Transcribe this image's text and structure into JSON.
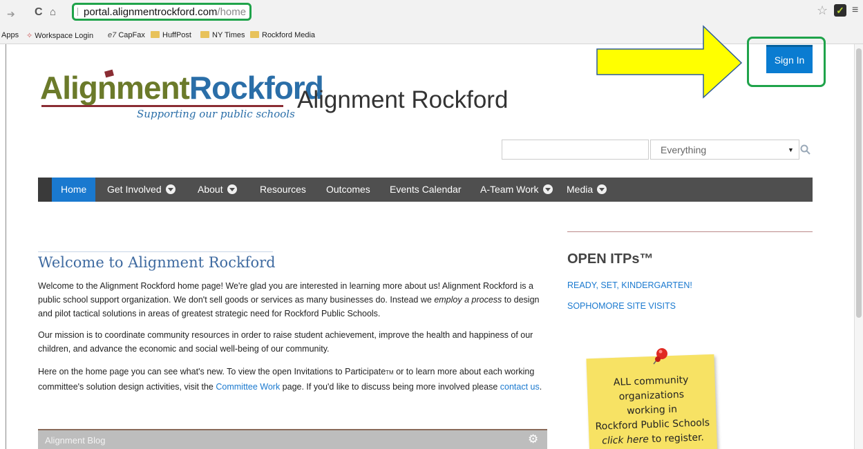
{
  "browser": {
    "url_host": "portal.alignmentrockford.com",
    "url_path": "/home",
    "bookmarks": [
      "Apps",
      "Workspace Login",
      "CapFax",
      "HuffPost",
      "NY Times",
      "Rockford Media"
    ]
  },
  "header": {
    "logo_word1": "Alignment",
    "logo_word2": "Rockford",
    "logo_tagline": "Supporting our public schools",
    "site_title": "Alignment Rockford",
    "signin_label": "Sign In"
  },
  "search": {
    "value": "",
    "scope": "Everything"
  },
  "nav": {
    "items": [
      {
        "label": "Home"
      },
      {
        "label": "Get Involved"
      },
      {
        "label": "About"
      },
      {
        "label": "Resources"
      },
      {
        "label": "Outcomes"
      },
      {
        "label": "Events Calendar"
      },
      {
        "label": "A-Team Work"
      },
      {
        "label": "Media"
      }
    ]
  },
  "main": {
    "heading": "Welcome to Alignment Rockford",
    "p1_a": "Welcome to the Alignment Rockford home page!  We're glad you are interested in learning more about us!  Alignment Rockford is a public school support organization.  We don't sell goods or services as many businesses do.  Instead we ",
    "p1_em": "employ a process",
    "p1_b": " to design and pilot tactical solutions in areas of greatest strategic need for Rockford Public Schools.",
    "p2": "Our mission is to coordinate community resources in order to raise student achievement, improve the health and happiness of our children, and advance the economic and social well-being of our community.",
    "p3_a": "Here on the home page you can see what's new. To view the open Invitations to Participate",
    "p3_tm": "TM",
    "p3_b": " or to learn more about each working committee's solution design activities, visit the ",
    "p3_link1": "Committee Work",
    "p3_c": " page. If you'd like to discuss being more involved please ",
    "p3_link2": "contact us",
    "p3_d": ".",
    "blog_title": "Alignment Blog"
  },
  "sidebar": {
    "heading": "OPEN ITPs™",
    "links": [
      "READY, SET, KINDERGARTEN!",
      "SOPHOMORE SITE VISITS"
    ],
    "note_line1": "ALL community",
    "note_line2": "organizations",
    "note_line3": "working in",
    "note_line4": "Rockford Public Schools",
    "note_em": "click here",
    "note_tail": " to register."
  },
  "colors": {
    "annotation_green": "#1fa34a",
    "annotation_arrow": "#ffff00",
    "accent_blue": "#1a79cf",
    "nav_bg": "#4f4f4f"
  }
}
